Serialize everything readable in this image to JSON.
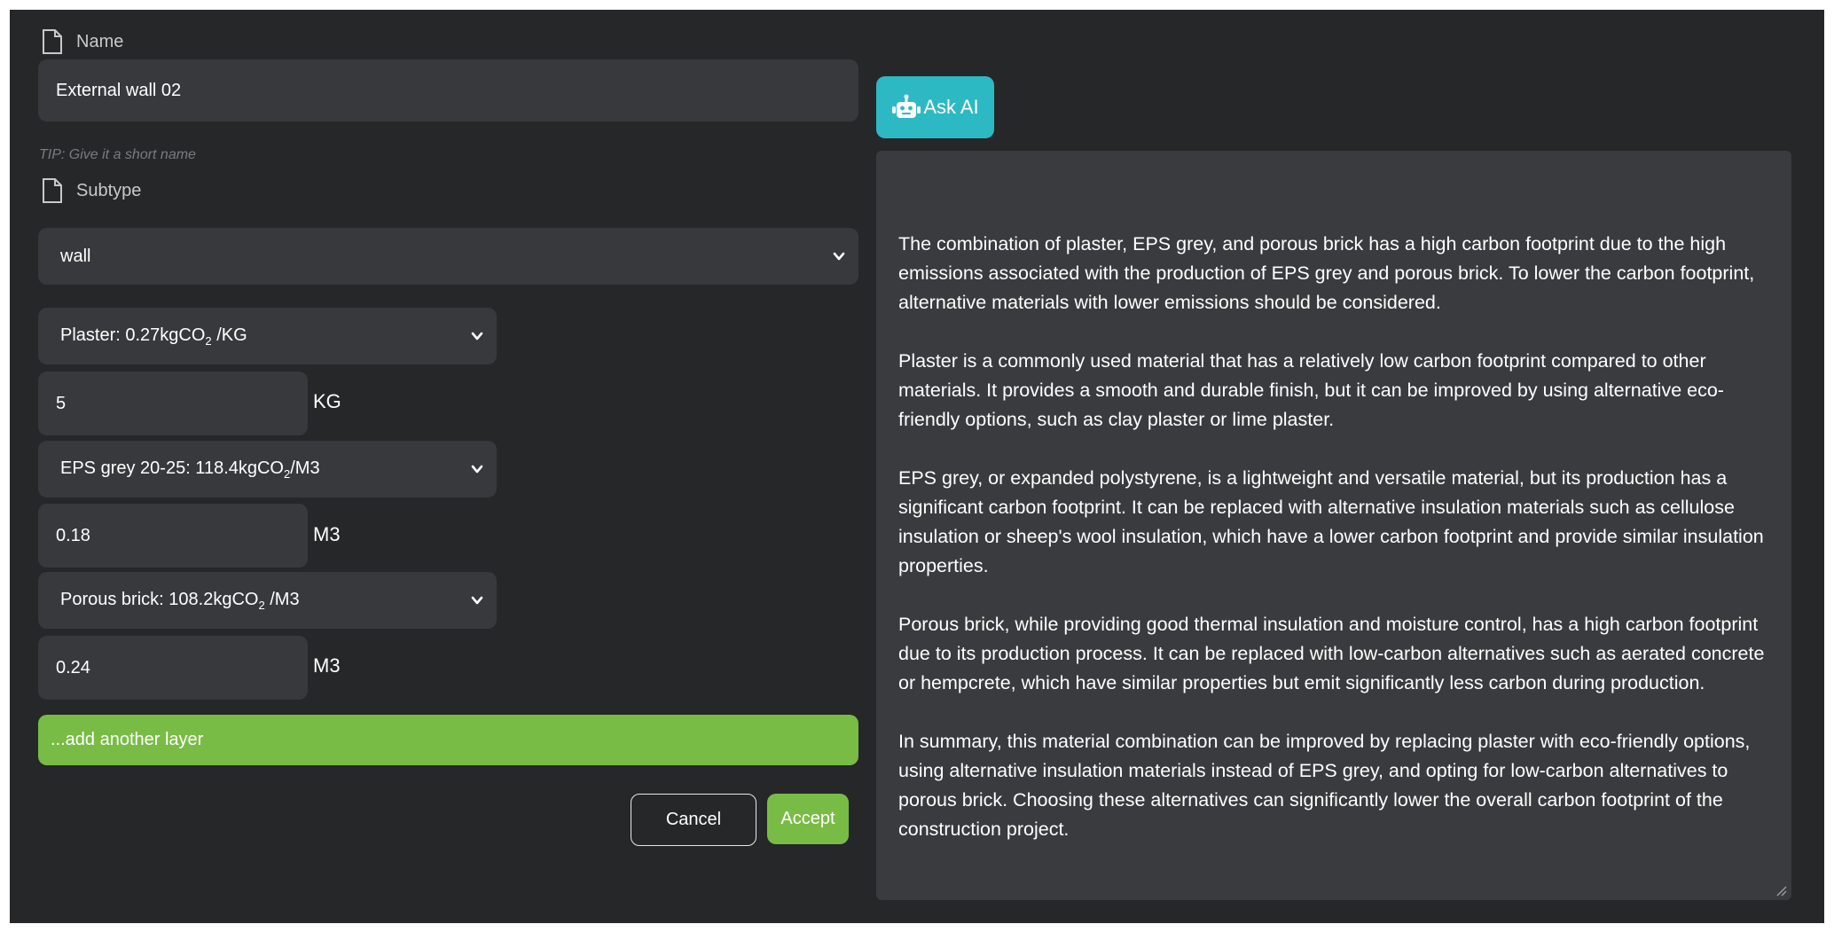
{
  "form": {
    "name_label": "Name",
    "name_value": "External wall 02",
    "name_tip": "TIP: Give it a short name",
    "subtype_label": "Subtype",
    "subtype_value": "wall"
  },
  "layers": [
    {
      "material_prefix": "Plaster: 0.27kgCO",
      "material_sub": "2",
      "material_suffix": "/KG",
      "quantity": "5",
      "unit": "KG"
    },
    {
      "material_prefix": "EPS grey 20-25: 118.4kgCO",
      "material_sub": "2",
      "material_suffix": "/M3",
      "quantity": "0.18",
      "unit": "M3"
    },
    {
      "material_prefix": "Porous brick: 108.2kgCO",
      "material_sub": "2",
      "material_suffix": "/M3",
      "quantity": "0.24",
      "unit": "M3"
    }
  ],
  "actions": {
    "add_layer": "...add another layer",
    "cancel": "Cancel",
    "accept": "Accept",
    "ask_ai": "Ask AI"
  },
  "ai_response": {
    "paragraphs": [
      "The combination of plaster, EPS grey, and porous brick has a high carbon footprint due to the high emissions associated with the production of EPS grey and porous brick. To lower the carbon footprint, alternative materials with lower emissions should be considered.",
      "Plaster is a commonly used material that has a relatively low carbon footprint compared to other materials. It provides a smooth and durable finish, but it can be improved by using alternative eco-friendly options, such as clay plaster or lime plaster.",
      "EPS grey, or expanded polystyrene, is a lightweight and versatile material, but its production has a significant carbon footprint. It can be replaced with alternative insulation materials such as cellulose insulation or sheep's wool insulation, which have a lower carbon footprint and provide similar insulation properties.",
      "Porous brick, while providing good thermal insulation and moisture control, has a high carbon footprint due to its production process. It can be replaced with low-carbon alternatives such as aerated concrete or hempcrete, which have similar properties but emit significantly less carbon during production.",
      "In summary, this material combination can be improved by replacing plaster with eco-friendly options, using alternative insulation materials instead of EPS grey, and opting for low-carbon alternatives to porous brick. Choosing these alternatives can significantly lower the overall carbon footprint of the construction project."
    ]
  },
  "icons": {
    "name_icon": "document-icon",
    "subtype_icon": "document-icon",
    "ask_ai_icon": "robot-icon",
    "select_icon": "chevron-down-icon"
  },
  "colors": {
    "background": "#262729",
    "field": "#38393c",
    "accent_green": "#79bc45",
    "accent_teal": "#2db9c4"
  }
}
